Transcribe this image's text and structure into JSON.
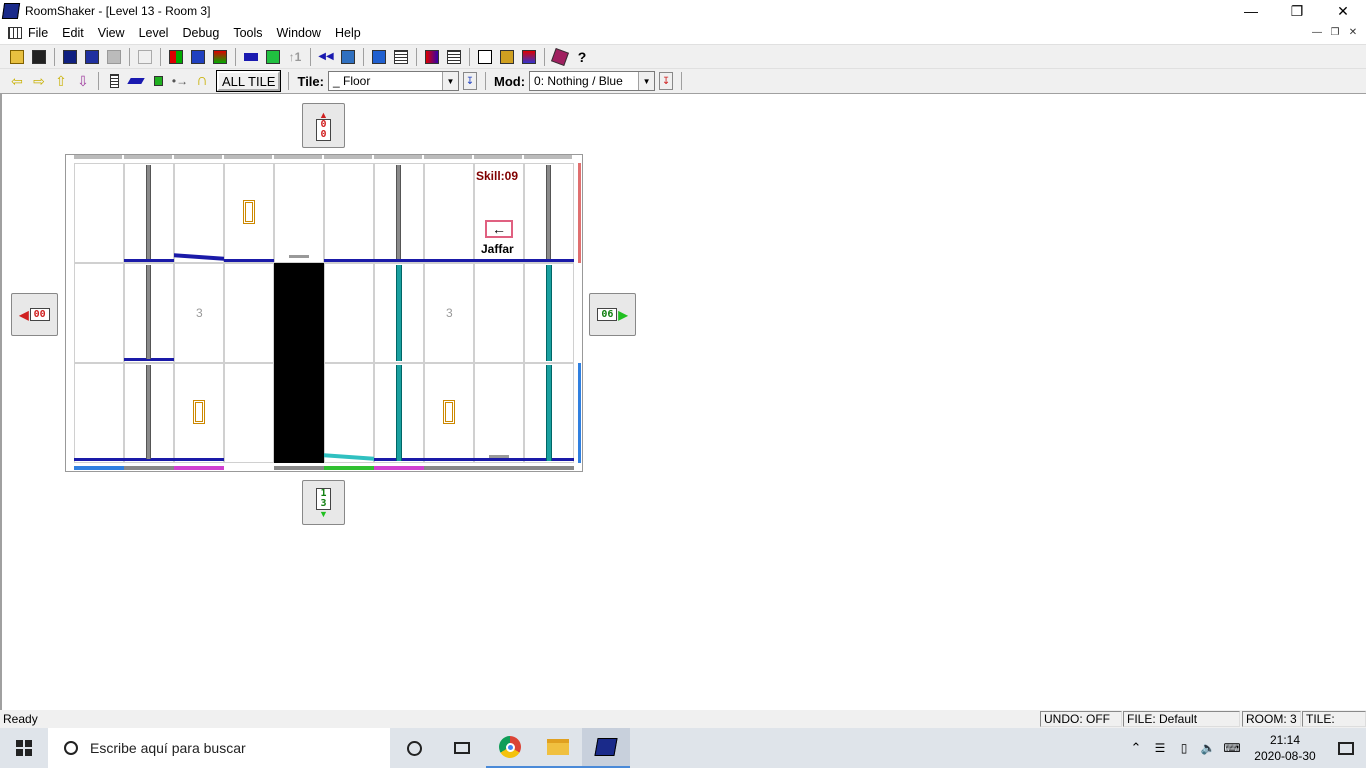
{
  "window": {
    "title": "RoomShaker - [Level 13 - Room 3]"
  },
  "menu": [
    "File",
    "Edit",
    "View",
    "Level",
    "Debug",
    "Tools",
    "Window",
    "Help"
  ],
  "toolbar2": {
    "all_tile": "ALL TILE",
    "tile_label": "Tile:",
    "tile_value": "_ Floor",
    "mod_label": "Mod:",
    "mod_value": "0: Nothing / Blue"
  },
  "nav": {
    "up": "0\n0",
    "up_top": "0",
    "up_bottom": "0",
    "left": "00",
    "right": "06",
    "down_top": "1",
    "down_bottom": "3"
  },
  "room": {
    "skill": "Skill:09",
    "guard_name": "Jaffar",
    "labels": [
      "3",
      "3"
    ]
  },
  "status": {
    "ready": "Ready",
    "undo": "UNDO: OFF",
    "file": "FILE: Default",
    "room": "ROOM: 3",
    "tile": "TILE:"
  },
  "taskbar": {
    "search_placeholder": "Escribe aquí para buscar",
    "time": "21:14",
    "date": "2020-08-30"
  },
  "colors": {
    "floor": "#1a1aa8",
    "pillar_gray": "#8a8a8a",
    "pillar_teal": "#1aa0a0",
    "wall": "#000000",
    "potion": "#cc8800"
  }
}
